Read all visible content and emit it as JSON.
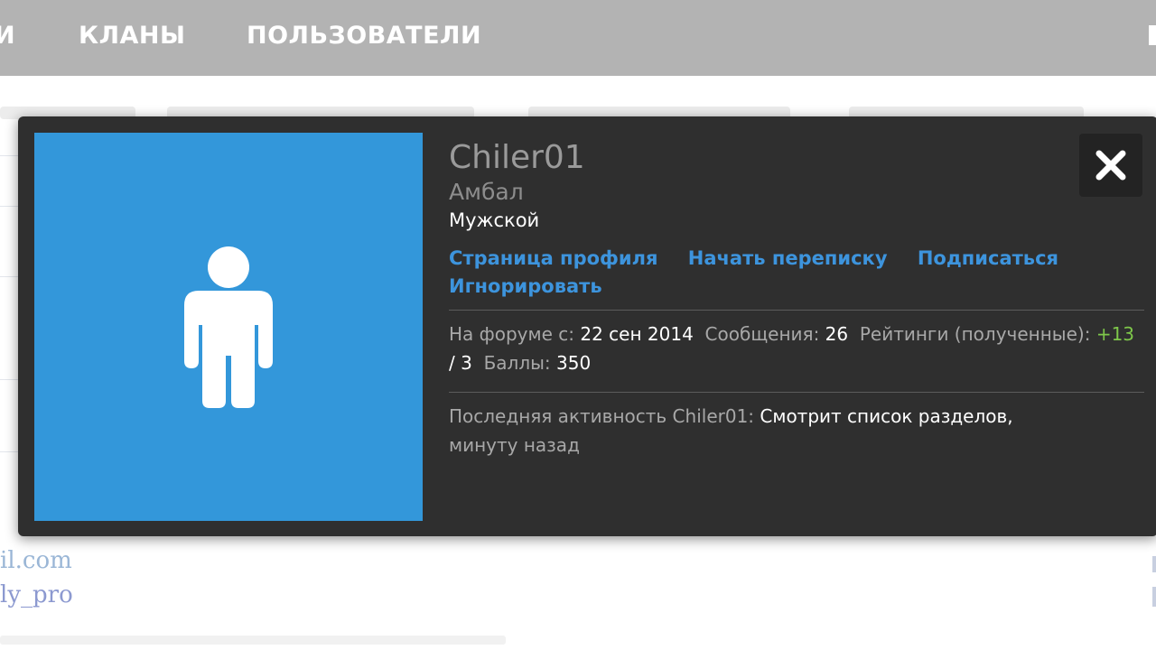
{
  "nav": {
    "partial_label": "И",
    "clans_label": "КЛАНЫ",
    "users_label": "ПОЛЬЗОВАТЕЛИ"
  },
  "background": {
    "email_fragment": "il.com",
    "username_fragment": "ly_pro"
  },
  "profile": {
    "username": "Chiler01",
    "title": "Амбал",
    "gender": "Мужской",
    "links": {
      "profile_page": "Страница профиля",
      "start_conversation": "Начать переписку",
      "follow": "Подписаться",
      "ignore": "Игнорировать"
    },
    "stats": {
      "joined_label": "На форуме с:",
      "joined_value": "22 сен 2014",
      "messages_label": "Сообщения:",
      "messages_value": "26",
      "ratings_label": "Рейтинги (полученные):",
      "ratings_positive": "+13",
      "ratings_separator": "/",
      "ratings_negative": "3",
      "points_label": "Баллы:",
      "points_value": "350"
    },
    "activity": {
      "label": "Последняя активность Chiler01:",
      "value": "Смотрит список разделов,",
      "time": "минуту назад"
    }
  },
  "icons": {
    "avatar": "person-silhouette-icon",
    "close": "close-icon"
  },
  "colors": {
    "card_bg": "#2f2f2f",
    "avatar_bg": "#3397da",
    "link": "#3d94dd",
    "positive": "#7ec74a",
    "nav_bg": "#b3b3b3"
  }
}
